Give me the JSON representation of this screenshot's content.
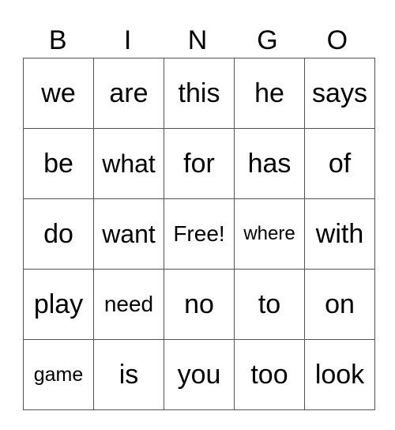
{
  "header": [
    "B",
    "I",
    "N",
    "G",
    "O"
  ],
  "cells": [
    [
      "we",
      "are",
      "this",
      "he",
      "says"
    ],
    [
      "be",
      "what",
      "for",
      "has",
      "of"
    ],
    [
      "do",
      "want",
      "Free!",
      "where",
      "with"
    ],
    [
      "play",
      "need",
      "no",
      "to",
      "on"
    ],
    [
      "game",
      "is",
      "you",
      "too",
      "look"
    ]
  ]
}
